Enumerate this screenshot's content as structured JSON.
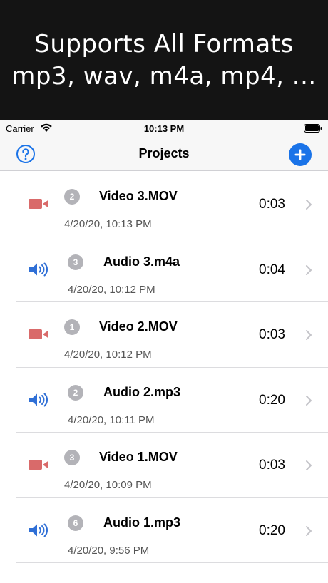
{
  "banner": {
    "line1": "Supports All Formats",
    "line2": "mp3, wav, m4a, mp4, ..."
  },
  "status_bar": {
    "carrier": "Carrier",
    "time": "10:13 PM"
  },
  "nav": {
    "title": "Projects",
    "help_icon": "question-circle-icon",
    "add_icon": "plus-circle-icon"
  },
  "colors": {
    "accent_blue": "#1a73e8",
    "video_icon": "#d96a6a",
    "audio_icon": "#2f6fd6",
    "badge_gray": "#b3b3b8"
  },
  "projects": [
    {
      "kind": "video",
      "icon": "video-camera-icon",
      "count": "2",
      "name": "Video 3.MOV",
      "date": "4/20/20, 10:13 PM",
      "duration": "0:03"
    },
    {
      "kind": "audio",
      "icon": "speaker-icon",
      "count": "3",
      "name": "Audio 3.m4a",
      "date": "4/20/20, 10:12 PM",
      "duration": "0:04"
    },
    {
      "kind": "video",
      "icon": "video-camera-icon",
      "count": "1",
      "name": "Video 2.MOV",
      "date": "4/20/20, 10:12 PM",
      "duration": "0:03"
    },
    {
      "kind": "audio",
      "icon": "speaker-icon",
      "count": "2",
      "name": "Audio 2.mp3",
      "date": "4/20/20, 10:11 PM",
      "duration": "0:20"
    },
    {
      "kind": "video",
      "icon": "video-camera-icon",
      "count": "3",
      "name": "Video 1.MOV",
      "date": "4/20/20, 10:09 PM",
      "duration": "0:03"
    },
    {
      "kind": "audio",
      "icon": "speaker-icon",
      "count": "6",
      "name": "Audio 1.mp3",
      "date": "4/20/20, 9:56 PM",
      "duration": "0:20"
    }
  ]
}
